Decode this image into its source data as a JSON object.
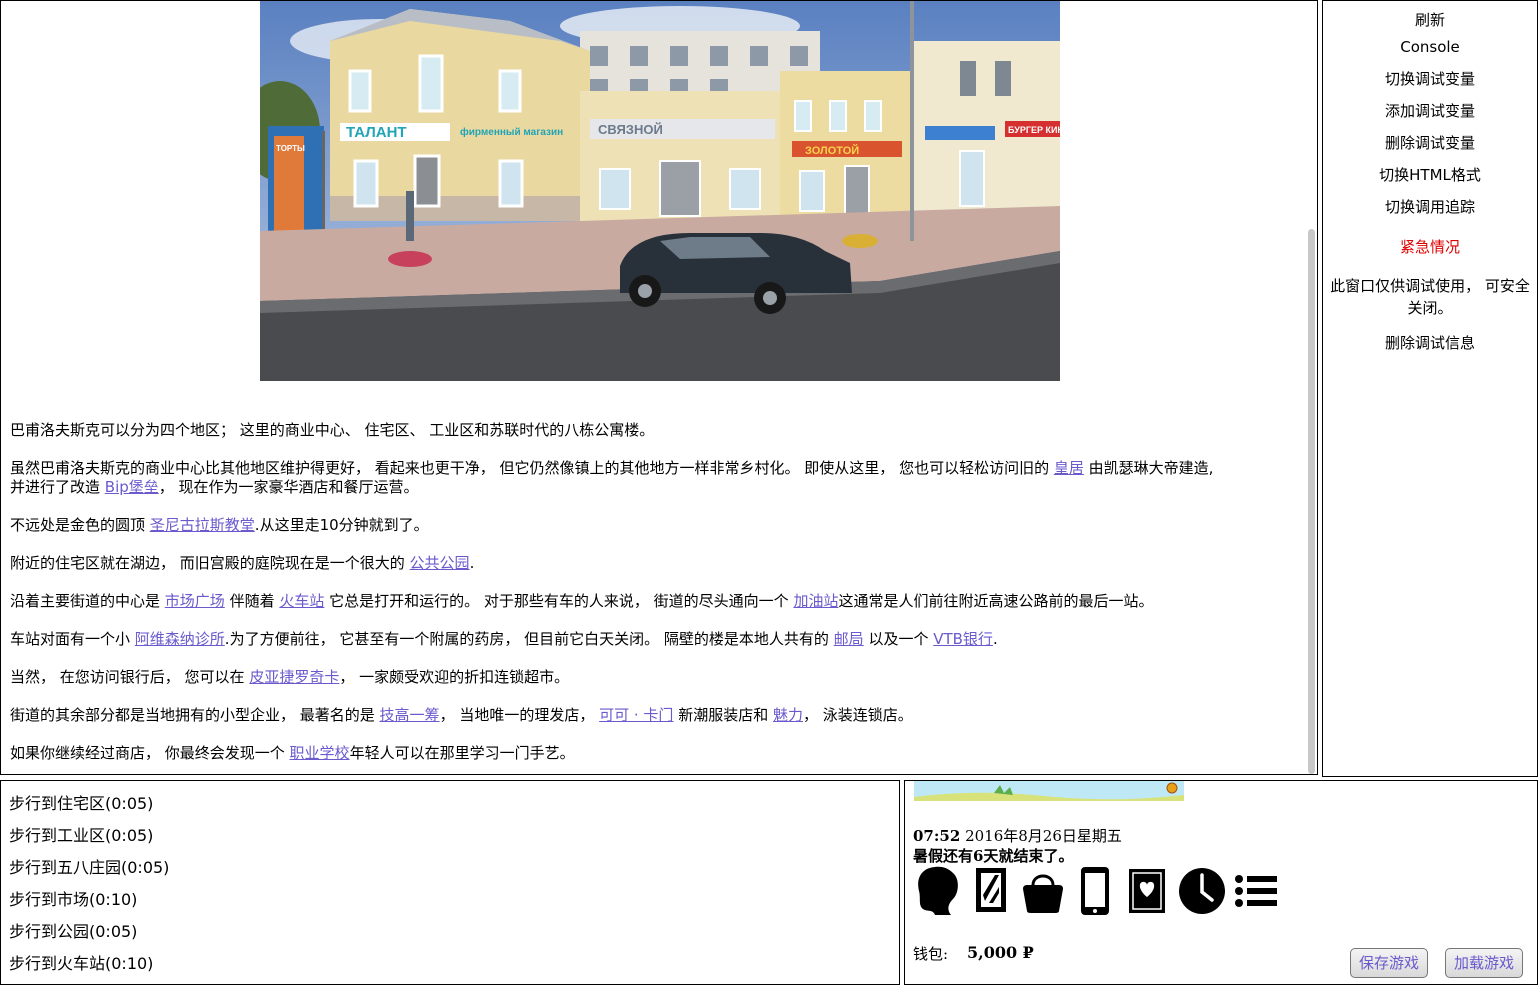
{
  "story": {
    "p1": "巴甫洛夫斯克可以分为四个地区； 这里的商业中心、 住宅区、 工业区和苏联时代的八栋公寓楼。",
    "p2_a": "虽然巴甫洛夫斯克的商业中心比其他地区维护得更好， 看起来也更干净， 但它仍然像镇上的其他地方一样非常乡村化。 即使从这里， 您也可以轻松访问旧的 ",
    "p2_link1": "皇居",
    "p2_b": " 由凯瑟琳大帝建造,",
    "p2_c": "并进行了改造 ",
    "p2_link2": "Bip堡垒",
    "p2_d": "， 现在作为一家豪华酒店和餐厅运营。",
    "p3_a": "不远处是金色的圆顶 ",
    "p3_link": "圣尼古拉斯教堂",
    "p3_b": ".从这里走10分钟就到了。",
    "p4_a": "附近的住宅区就在湖边， 而旧宫殿的庭院现在是一个很大的 ",
    "p4_link": "公共公园",
    "p4_b": ".",
    "p5_a": "沿着主要街道的中心是 ",
    "p5_link1": "市场广场",
    "p5_b": " 伴随着 ",
    "p5_link2": "火车站",
    "p5_c": " 它总是打开和运行的。 对于那些有车的人来说， 街道的尽头通向一个 ",
    "p5_link3": "加油站",
    "p5_d": "这通常是人们前往附近高速公路前的最后一站。",
    "p6_a": "车站对面有一个小 ",
    "p6_link1": "阿维森纳诊所",
    "p6_b": ".为了方便前往， 它甚至有一个附属的药房， 但目前它白天关闭。 隔壁的楼是本地人共有的 ",
    "p6_link2": "邮局",
    "p6_c": " 以及一个 ",
    "p6_link3": "VTB银行",
    "p6_d": ".",
    "p7_a": "当然， 在您访问银行后， 您可以在 ",
    "p7_link": "皮亚捷罗奇卡",
    "p7_b": "， 一家颇受欢迎的折扣连锁超市。",
    "p8_a": "街道的其余部分都是当地拥有的小型企业， 最著名的是 ",
    "p8_link1": "技高一筹",
    "p8_b": "， 当地唯一的理发店， ",
    "p8_link2": "可可 · 卡门",
    "p8_c": " 新潮服装店和 ",
    "p8_link3": "魅力",
    "p8_d": "， 泳装连锁店。",
    "p9_a": "如果你继续经过商店， 你最终会发现一个 ",
    "p9_link": "职业学校",
    "p9_b": "年轻人可以在那里学习一门手艺。"
  },
  "scene_signs": {
    "talant": "ТАЛАНТ",
    "firm": "фирменный магазин",
    "svyaznoy": "СВЯЗНОЙ",
    "zoloto": "ЗОЛОТОЙ",
    "burger": "БУРГЕР КИНГ",
    "poster": "ТОРТЫ"
  },
  "debug": {
    "refresh": "刷新",
    "console": "Console",
    "toggle_vars": "切换调试变量",
    "add_var": "添加调试变量",
    "delete_var": "删除调试变量",
    "toggle_html": "切换HTML格式",
    "toggle_trace": "切换调用追踪",
    "emergency": "紧急情况",
    "note": "此窗口仅供调试使用， 可安全关闭。",
    "delete_info": "删除调试信息"
  },
  "actions": [
    "步行到住宅区(0:05)",
    "步行到工业区(0:05)",
    "步行到五八庄园(0:05)",
    "步行到市场(0:10)",
    "步行到公园(0:05)",
    "步行到火车站(0:10)"
  ],
  "status": {
    "time": "07:52",
    "date": "2016年8月26日星期五",
    "notice": "暑假还有6天就结束了。",
    "wallet_label": "钱包:",
    "wallet_amount": "5,000 ₽",
    "save": "保存游戏",
    "load": "加载游戏"
  },
  "icons": [
    "woman-head-icon",
    "mirror-icon",
    "handbag-icon",
    "phone-icon",
    "diary-heart-icon",
    "clock-icon",
    "menu-list-icon"
  ]
}
